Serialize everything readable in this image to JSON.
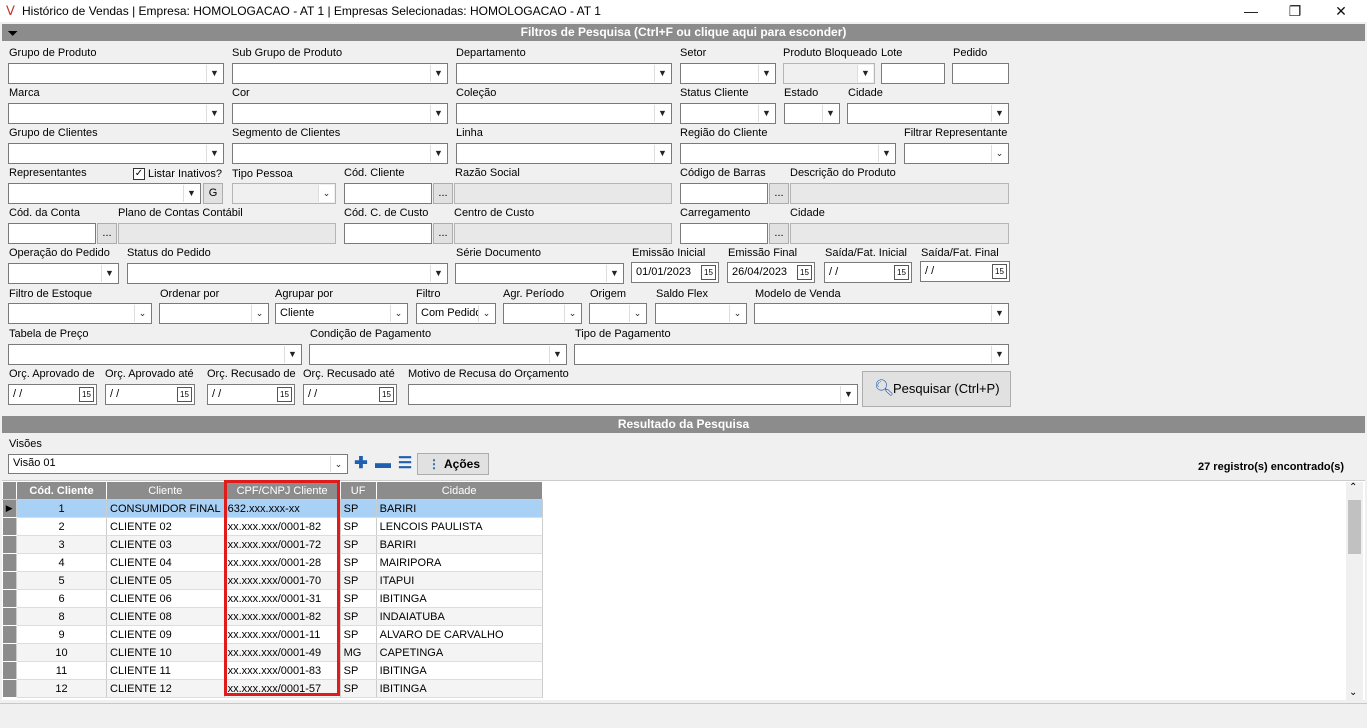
{
  "window": {
    "title": "Histórico de Vendas | Empresa: HOMOLOGACAO - AT 1 | Empresas Selecionadas: HOMOLOGACAO - AT 1",
    "minimize": "—",
    "maximize": "❐",
    "close": "✕"
  },
  "filters": {
    "header": "Filtros de Pesquisa (Ctrl+F ou clique aqui para esconder)",
    "labels": {
      "grupo_produto": "Grupo de Produto",
      "sub_grupo": "Sub Grupo de Produto",
      "departamento": "Departamento",
      "setor": "Setor",
      "produto_bloqueado": "Produto Bloqueado",
      "lote": "Lote",
      "pedido": "Pedido",
      "marca": "Marca",
      "cor": "Cor",
      "colecao": "Coleção",
      "status_cliente": "Status Cliente",
      "estado": "Estado",
      "cidade": "Cidade",
      "grupo_clientes": "Grupo de Clientes",
      "segmento_clientes": "Segmento de Clientes",
      "linha": "Linha",
      "regiao_cliente": "Região do Cliente",
      "filtrar_representante": "Filtrar Representante",
      "representantes": "Representantes",
      "listar_inativos": "Listar Inativos?",
      "tipo_pessoa": "Tipo Pessoa",
      "cod_cliente": "Cód. Cliente",
      "razao_social": "Razão Social",
      "codigo_barras": "Código de Barras",
      "descricao_produto": "Descrição do Produto",
      "cod_conta": "Cód. da Conta",
      "plano_contas": "Plano de Contas Contábil",
      "cod_c_custo": "Cód. C. de Custo",
      "centro_custo": "Centro de Custo",
      "carregamento": "Carregamento",
      "cidade2": "Cidade",
      "operacao_pedido": "Operação do Pedido",
      "status_pedido": "Status do Pedido",
      "serie_documento": "Série Documento",
      "emissao_inicial": "Emissão Inicial",
      "emissao_final": "Emissão Final",
      "saida_inicial": "Saída/Fat. Inicial",
      "saida_final": "Saída/Fat. Final",
      "filtro_estoque": "Filtro de Estoque",
      "ordenar_por": "Ordenar por",
      "agrupar_por": "Agrupar por",
      "filtro": "Filtro",
      "agr_periodo": "Agr. Período",
      "origem": "Origem",
      "saldo_flex": "Saldo Flex",
      "modelo_venda": "Modelo de Venda",
      "tabela_preco": "Tabela de Preço",
      "condicao_pagamento": "Condição de Pagamento",
      "tipo_pagamento": "Tipo de Pagamento",
      "orc_aprovado_de": "Orç. Aprovado de",
      "orc_aprovado_ate": "Orç. Aprovado até",
      "orc_recusado_de": "Orç. Recusado de",
      "orc_recusado_ate": "Orç. Recusado até",
      "motivo_recusa": "Motivo de Recusa do Orçamento"
    },
    "values": {
      "emissao_inicial": "01/01/2023",
      "emissao_final": "26/04/2023",
      "saida_inicial": " / /",
      "saida_final": " / /",
      "agrupar_por": "Cliente",
      "filtro": "Com Pedido",
      "orc_aprovado_de": " / /",
      "orc_aprovado_ate": " / /",
      "orc_recusado_de": " / /",
      "orc_recusado_ate": " / /"
    },
    "g_button": "G",
    "ellipsis": "...",
    "search_button": "Pesquisar (Ctrl+P)"
  },
  "results": {
    "header": "Resultado da Pesquisa",
    "visoes_label": "Visões",
    "visao_selected": "Visão 01",
    "acoes_label": "Ações",
    "count_text": "27 registro(s) encontrado(s)",
    "columns": [
      "Cód. Cliente",
      "Cliente",
      "CPF/CNPJ Cliente",
      "UF",
      "Cidade"
    ],
    "rows": [
      [
        "1",
        "CONSUMIDOR FINAL",
        "632.xxx.xxx-xx",
        "SP",
        "BARIRI"
      ],
      [
        "2",
        "CLIENTE 02",
        "xx.xxx.xxx/0001-82",
        "SP",
        "LENCOIS PAULISTA"
      ],
      [
        "3",
        "CLIENTE 03",
        "xx.xxx.xxx/0001-72",
        "SP",
        "BARIRI"
      ],
      [
        "4",
        "CLIENTE 04",
        "xx.xxx.xxx/0001-28",
        "SP",
        "MAIRIPORA"
      ],
      [
        "5",
        "CLIENTE 05",
        "xx.xxx.xxx/0001-70",
        "SP",
        "ITAPUI"
      ],
      [
        "6",
        "CLIENTE 06",
        "xx.xxx.xxx/0001-31",
        "SP",
        "IBITINGA"
      ],
      [
        "8",
        "CLIENTE 08",
        "xx.xxx.xxx/0001-82",
        "SP",
        "INDAIATUBA"
      ],
      [
        "9",
        "CLIENTE 09",
        "xx.xxx.xxx/0001-11",
        "SP",
        "ALVARO DE CARVALHO"
      ],
      [
        "10",
        "CLIENTE 10",
        "xx.xxx.xxx/0001-49",
        "MG",
        "CAPETINGA"
      ],
      [
        "11",
        "CLIENTE 11",
        "xx.xxx.xxx/0001-83",
        "SP",
        "IBITINGA"
      ],
      [
        "12",
        "CLIENTE 12",
        "xx.xxx.xxx/0001-57",
        "SP",
        "IBITINGA"
      ]
    ]
  },
  "colors": {
    "section_header": "#8c8c8c",
    "selected_row": "#a9d1f5",
    "highlight_box": "#e01b1b",
    "icon_blue": "#1f5fb0"
  }
}
